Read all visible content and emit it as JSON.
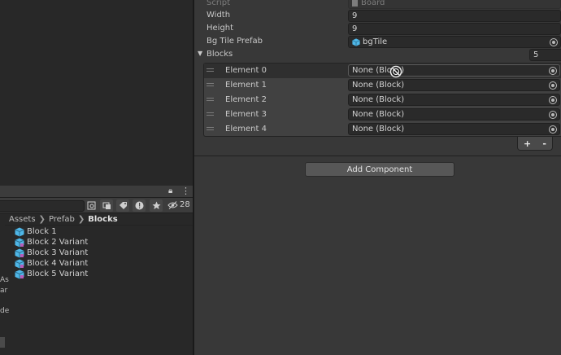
{
  "inspector": {
    "script": {
      "label": "Script",
      "value": "Board"
    },
    "width": {
      "label": "Width",
      "value": "9"
    },
    "height": {
      "label": "Height",
      "value": "9"
    },
    "bg_tile_prefab": {
      "label": "Bg Tile Prefab",
      "value": "bgTile"
    },
    "blocks": {
      "label": "Blocks",
      "size": "5",
      "elements": [
        {
          "label": "Element 0",
          "value": "None (Block)"
        },
        {
          "label": "Element 1",
          "value": "None (Block)"
        },
        {
          "label": "Element 2",
          "value": "None (Block)"
        },
        {
          "label": "Element 3",
          "value": "None (Block)"
        },
        {
          "label": "Element 4",
          "value": "None (Block)"
        }
      ],
      "add_label": "+",
      "remove_label": "-"
    },
    "add_component_label": "Add Component"
  },
  "project": {
    "hidden_count": "28",
    "breadcrumb": [
      "Assets",
      "Prefab",
      "Blocks"
    ],
    "assets": [
      {
        "name": "Block 1",
        "icon": "prefab-cube-icon"
      },
      {
        "name": "Block 2 Variant",
        "icon": "prefab-variant-cube-icon"
      },
      {
        "name": "Block 3 Variant",
        "icon": "prefab-variant-cube-icon"
      },
      {
        "name": "Block 4 Variant",
        "icon": "prefab-variant-cube-icon"
      },
      {
        "name": "Block 5 Variant",
        "icon": "prefab-variant-cube-icon"
      }
    ],
    "left_fragments": [
      "As",
      "ar",
      "de"
    ]
  },
  "colors": {
    "prefab_blue": "#4fb7e8",
    "background": "#282828",
    "inspector_bg": "#383838",
    "field_bg": "#2a2a2a"
  }
}
